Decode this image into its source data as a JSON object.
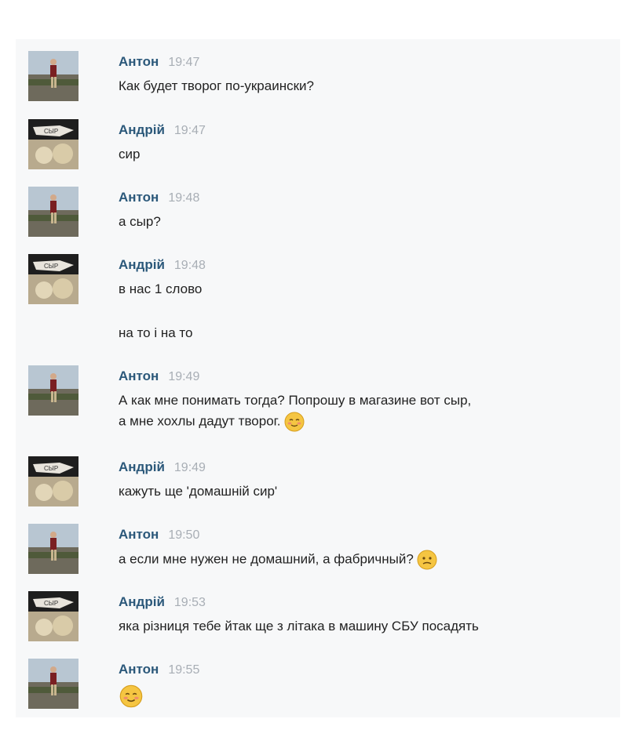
{
  "messages": [
    {
      "author": "Антон",
      "time": "19:47",
      "lines": [
        "Как будет творог по-украински?"
      ],
      "avatar": "anton"
    },
    {
      "author": "Андрій",
      "time": "19:47",
      "lines": [
        "сир"
      ],
      "avatar": "andriy"
    },
    {
      "author": "Антон",
      "time": "19:48",
      "lines": [
        "а сыр?"
      ],
      "avatar": "anton"
    },
    {
      "author": "Андрій",
      "time": "19:48",
      "lines": [
        "в нас 1 слово"
      ],
      "avatar": "andriy"
    },
    {
      "author": "Андрій",
      "time": "",
      "lines": [
        "на то і на то"
      ],
      "avatar": "none"
    },
    {
      "author": "Антон",
      "time": "19:49",
      "lines": [
        "А как мне понимать тогда? Попрошу в магазине вот сыр,",
        "а мне хохлы дадут творог."
      ],
      "avatar": "anton",
      "emoji": "blush-smile-icon"
    },
    {
      "author": "Андрій",
      "time": "19:49",
      "lines": [
        "кажуть ще 'домашній сир'"
      ],
      "avatar": "andriy"
    },
    {
      "author": "Антон",
      "time": "19:50",
      "lines": [
        "а если мне нужен не домашний, а фабричный?"
      ],
      "avatar": "anton",
      "emoji": "confused-face-icon"
    },
    {
      "author": "Андрій",
      "time": "19:53",
      "lines": [
        "яка різниця тебе йтак ще з літака в машину СБУ посадять"
      ],
      "avatar": "andriy"
    },
    {
      "author": "Антон",
      "time": "19:55",
      "lines": [],
      "avatar": "anton",
      "emoji": "blush-smile-icon"
    }
  ],
  "colors": {
    "author": "#2b587a",
    "time": "#a8aeb5",
    "text": "#222222",
    "panel": "#f7f8f9"
  }
}
